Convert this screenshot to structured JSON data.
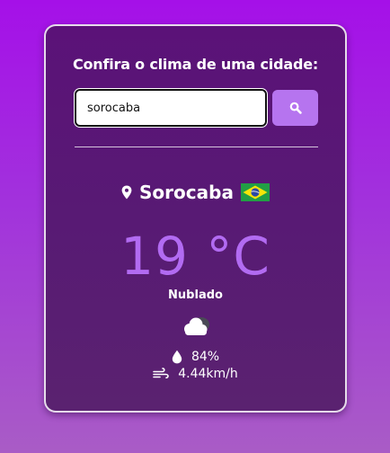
{
  "search": {
    "heading": "Confira o clima de uma cidade:",
    "value": "sorocaba",
    "button_icon": "search-icon"
  },
  "weather": {
    "location_icon": "map-pin-icon",
    "city": "Sorocaba",
    "country_flag": "brazil-flag-icon",
    "temperature": "19 °C",
    "description": "Nublado",
    "condition_icon": "cloud-icon",
    "humidity_icon": "water-drop-icon",
    "humidity": "84%",
    "wind_icon": "wind-icon",
    "wind": "4.44km/h"
  },
  "colors": {
    "accent": "#b674ef",
    "temperature": "#b26bf2",
    "card": "#581a74"
  }
}
